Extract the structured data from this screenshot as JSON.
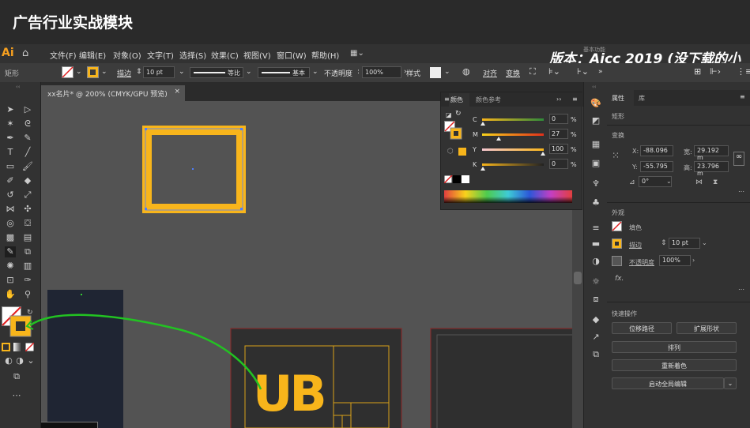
{
  "title": "广告行业实战模块",
  "banner": "版本：Aicc 2019 (没下载的小",
  "menu": [
    "文件(F)",
    "编辑(E)",
    "对象(O)",
    "文字(T)",
    "选择(S)",
    "效果(C)",
    "视图(V)",
    "窗口(W)",
    "帮助(H)"
  ],
  "control": {
    "object_type": "矩形",
    "stroke_label": "描边",
    "stroke_value": "10 pt",
    "profile": "等比",
    "brush": "基本",
    "opacity_label": "不透明度",
    "opacity_value": "100%",
    "style_label": "样式",
    "align": "对齐",
    "transform": "变换",
    "stage_label": "基本功能"
  },
  "doc_tab": {
    "label": "xx名片* @ 200% (CMYK/GPU 预览)",
    "close": "×"
  },
  "color_panel": {
    "tab_color": "颜色",
    "tab_guide": "颜色参考",
    "channels": [
      {
        "name": "C",
        "value": "0",
        "unit": "%"
      },
      {
        "name": "M",
        "value": "27",
        "unit": "%"
      },
      {
        "name": "Y",
        "value": "100",
        "unit": "%"
      },
      {
        "name": "K",
        "value": "0",
        "unit": "%"
      }
    ]
  },
  "properties": {
    "tab_props": "属性",
    "tab_lib": "库",
    "object_type": "矩形",
    "transform_title": "变换",
    "x_label": "X:",
    "x_value": "-88.096",
    "y_label": "Y:",
    "y_value": "-55.795",
    "w_label": "宽:",
    "w_value": "29.192 m",
    "h_label": "高:",
    "h_value": "23.796 m",
    "angle_value": "0°",
    "appearance_title": "外观",
    "fill_label": "填色",
    "stroke_label": "描边",
    "stroke_value": "10 pt",
    "opacity_label": "不透明度",
    "opacity_value": "100%",
    "fx": "fx.",
    "quick_title": "快速操作",
    "btn_offset": "位移路径",
    "btn_expand": "扩展形状",
    "btn_arrange": "排列",
    "btn_recolor": "重新着色",
    "btn_global": "启动全局编辑"
  },
  "logo_text": "UB",
  "colors": {
    "accent": "#f8b51b",
    "chrome": "#323232",
    "canvas": "#535353",
    "annotation": "#22c322"
  }
}
